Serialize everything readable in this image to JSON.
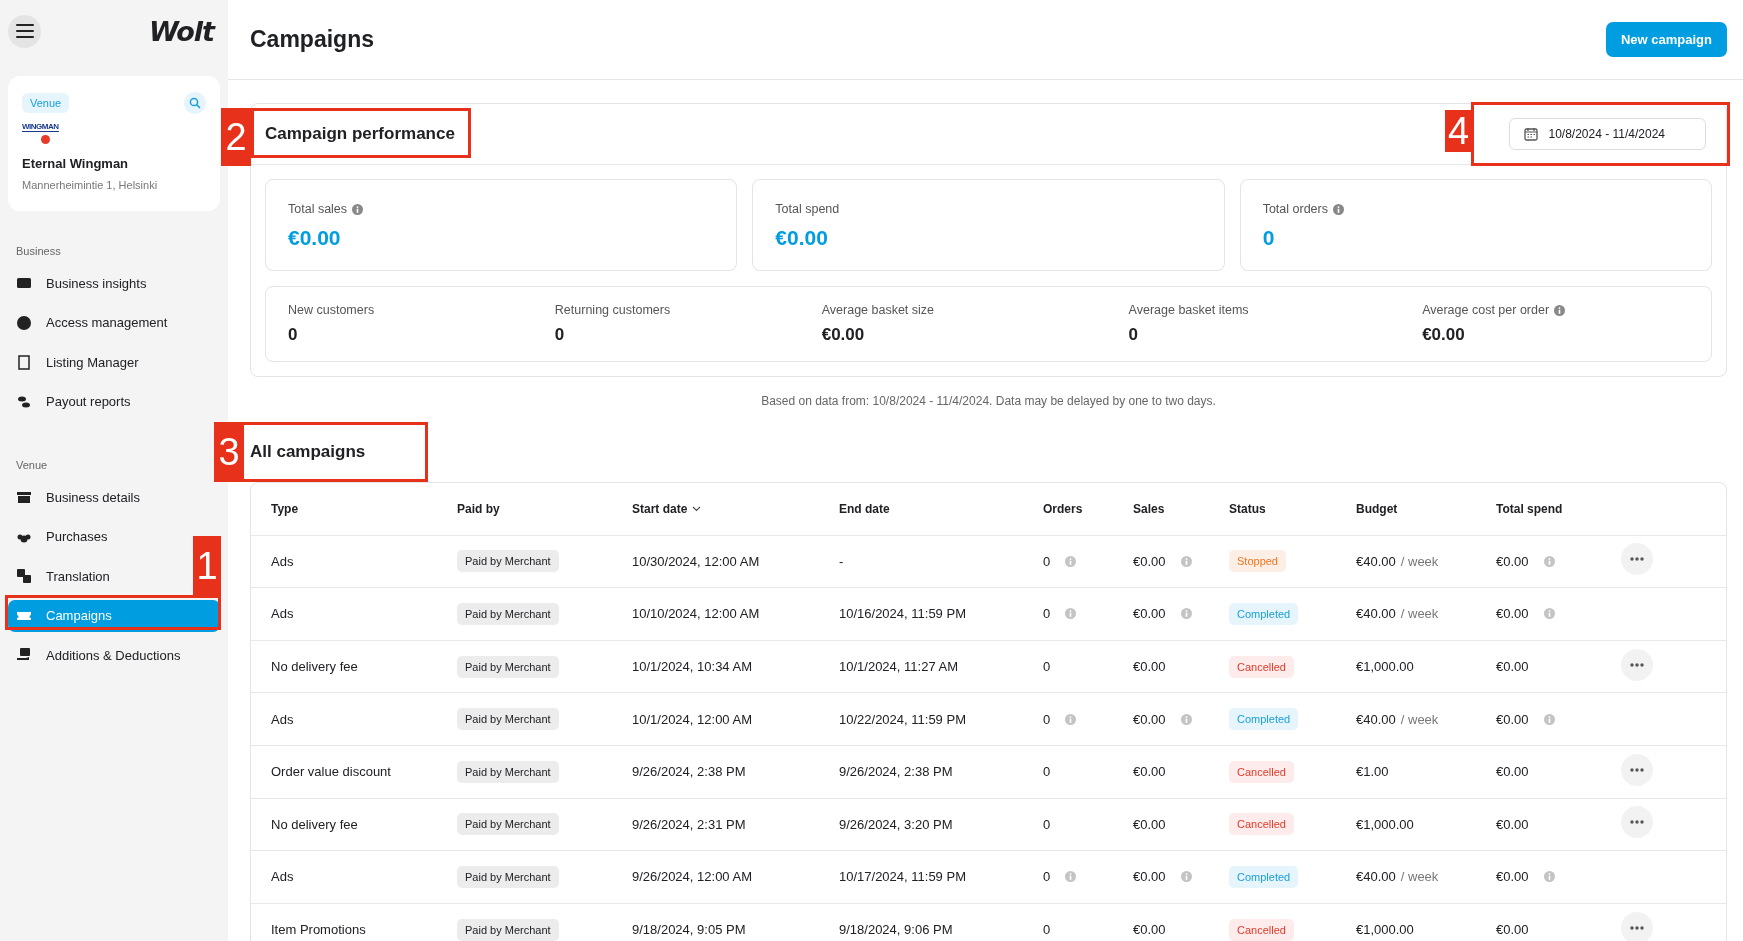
{
  "sidebar": {
    "logo": "Wolt",
    "venue_card": {
      "badge": "Venue",
      "logo_text": "WINGMAN",
      "name": "Eternal Wingman",
      "address": "Mannerheimintie 1, Helsinki"
    },
    "sections": [
      {
        "title": "Business",
        "items": [
          {
            "label": "Business insights",
            "selected": false
          },
          {
            "label": "Access management",
            "selected": false
          },
          {
            "label": "Listing Manager",
            "selected": false
          },
          {
            "label": "Payout reports",
            "selected": false
          }
        ]
      },
      {
        "title": "Venue",
        "items": [
          {
            "label": "Business details",
            "selected": false
          },
          {
            "label": "Purchases",
            "selected": false
          },
          {
            "label": "Translation",
            "selected": false
          },
          {
            "label": "Campaigns",
            "selected": true,
            "annotation": "1"
          },
          {
            "label": "Additions & Deductions",
            "selected": false
          }
        ]
      }
    ]
  },
  "header": {
    "title": "Campaigns",
    "button": "New campaign"
  },
  "performance": {
    "title": "Campaign performance",
    "title_annotation": "2",
    "date_range": "10/8/2024 - 11/4/2024",
    "date_annotation": "4",
    "main_stats": [
      {
        "label": "Total sales",
        "value": "€0.00",
        "info": true
      },
      {
        "label": "Total spend",
        "value": "€0.00",
        "info": false
      },
      {
        "label": "Total orders",
        "value": "0",
        "info": true
      }
    ],
    "stats": [
      {
        "label": "New customers",
        "value": "0",
        "info": false
      },
      {
        "label": "Returning customers",
        "value": "0",
        "info": false
      },
      {
        "label": "Average basket size",
        "value": "€0.00",
        "info": false
      },
      {
        "label": "Average basket items",
        "value": "0",
        "info": false
      },
      {
        "label": "Average cost per order",
        "value": "€0.00",
        "info": true
      }
    ],
    "note": "Based on data from: 10/8/2024 - 11/4/2024. Data may be delayed by one to two days."
  },
  "campaigns": {
    "title": "All campaigns",
    "title_annotation": "3",
    "columns": [
      "Type",
      "Paid by",
      "Start date",
      "End date",
      "Orders",
      "Sales",
      "Status",
      "Budget",
      "Total spend"
    ],
    "rows": [
      {
        "type": "Ads",
        "paid_by": "Paid by Merchant",
        "start": "10/30/2024, 12:00 AM",
        "end": "-",
        "orders": "0",
        "sales": "€0.00",
        "status": {
          "kind": "stopped",
          "label": "Stopped"
        },
        "budget": "€40.00",
        "budget_unit": "/ week",
        "spend": "€0.00",
        "info": true,
        "menu": true
      },
      {
        "type": "Ads",
        "paid_by": "Paid by Merchant",
        "start": "10/10/2024, 12:00 AM",
        "end": "10/16/2024, 11:59 PM",
        "orders": "0",
        "sales": "€0.00",
        "status": {
          "kind": "completed",
          "label": "Completed"
        },
        "budget": "€40.00",
        "budget_unit": "/ week",
        "spend": "€0.00",
        "info": true,
        "menu": false
      },
      {
        "type": "No delivery fee",
        "paid_by": "Paid by Merchant",
        "start": "10/1/2024, 10:34 AM",
        "end": "10/1/2024, 11:27 AM",
        "orders": "0",
        "sales": "€0.00",
        "status": {
          "kind": "cancelled",
          "label": "Cancelled"
        },
        "budget": "€1,000.00",
        "spend": "€0.00",
        "info": false,
        "menu": true
      },
      {
        "type": "Ads",
        "paid_by": "Paid by Merchant",
        "start": "10/1/2024, 12:00 AM",
        "end": "10/22/2024, 11:59 PM",
        "orders": "0",
        "sales": "€0.00",
        "status": {
          "kind": "completed",
          "label": "Completed"
        },
        "budget": "€40.00",
        "budget_unit": "/ week",
        "spend": "€0.00",
        "info": true,
        "menu": false
      },
      {
        "type": "Order value discount",
        "paid_by": "Paid by Merchant",
        "start": "9/26/2024, 2:38 PM",
        "end": "9/26/2024, 2:38 PM",
        "orders": "0",
        "sales": "€0.00",
        "status": {
          "kind": "cancelled",
          "label": "Cancelled"
        },
        "budget": "€1.00",
        "spend": "€0.00",
        "info": false,
        "menu": true
      },
      {
        "type": "No delivery fee",
        "paid_by": "Paid by Merchant",
        "start": "9/26/2024, 2:31 PM",
        "end": "9/26/2024, 3:20 PM",
        "orders": "0",
        "sales": "€0.00",
        "status": {
          "kind": "cancelled",
          "label": "Cancelled"
        },
        "budget": "€1,000.00",
        "spend": "€0.00",
        "info": false,
        "menu": true
      },
      {
        "type": "Ads",
        "paid_by": "Paid by Merchant",
        "start": "9/26/2024, 12:00 AM",
        "end": "10/17/2024, 11:59 PM",
        "orders": "0",
        "sales": "€0.00",
        "status": {
          "kind": "completed",
          "label": "Completed"
        },
        "budget": "€40.00",
        "budget_unit": "/ week",
        "spend": "€0.00",
        "info": true,
        "menu": false
      },
      {
        "type": "Item Promotions",
        "paid_by": "Paid by Merchant",
        "start": "9/18/2024, 9:05 PM",
        "end": "9/18/2024, 9:06 PM",
        "orders": "0",
        "sales": "€0.00",
        "status": {
          "kind": "cancelled",
          "label": "Cancelled"
        },
        "budget": "€1,000.00",
        "spend": "€0.00",
        "info": false,
        "menu": true
      }
    ]
  }
}
